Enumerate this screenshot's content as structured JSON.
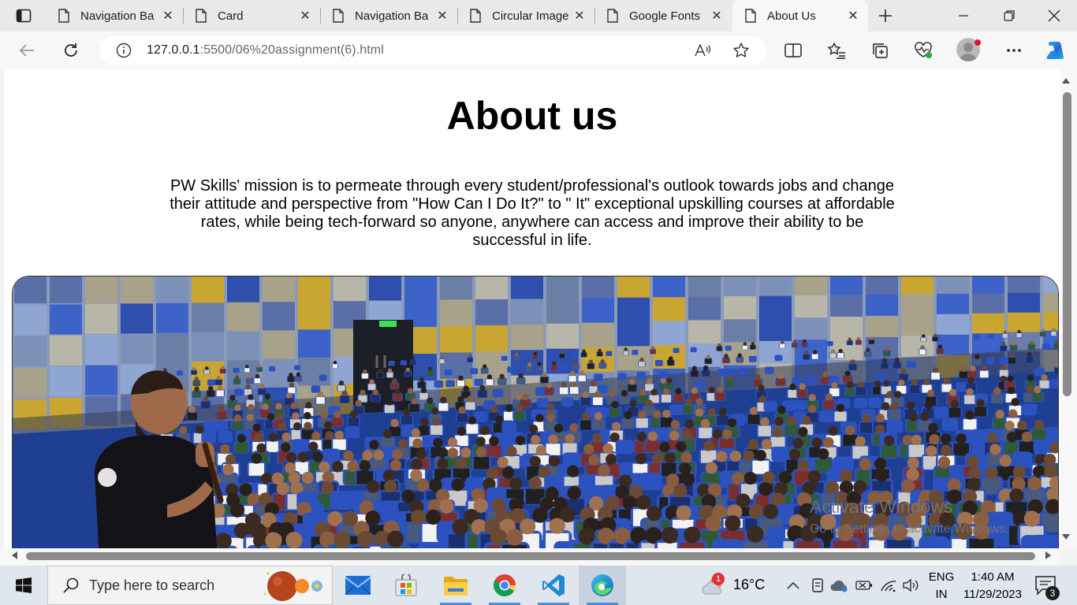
{
  "browser": {
    "tabs": [
      {
        "title": "Navigation Ba",
        "active": false
      },
      {
        "title": "Card",
        "active": false
      },
      {
        "title": "Navigation Ba",
        "active": false
      },
      {
        "title": "Circular Image",
        "active": false
      },
      {
        "title": "Google Fonts",
        "active": false
      },
      {
        "title": "About Us",
        "active": true
      }
    ],
    "close_glyph": "✕",
    "new_tab_glyph": "+",
    "url_host": "127.0.0.1",
    "url_rest": ":5500/06%20assignment(6).html"
  },
  "page": {
    "heading": "About us",
    "paragraph": "PW Skills' mission is to permeate through every student/professional's outlook towards jobs and change their attitude and perspective from \"How Can I Do It?\" to \" It\" exceptional upskilling courses at affordable rates, while being tech-forward so anyone, anywhere can access and improve their ability to be successful in life.",
    "watermark_title": "Activate Windows",
    "watermark_subtitle": "Go to Settings to activate Windows."
  },
  "taskbar": {
    "search_placeholder": "Type here to search",
    "weather_temp": "16°C",
    "weather_badge": "1",
    "lang_line1": "ENG",
    "lang_line2": "IN",
    "time": "1:40 AM",
    "date": "11/29/2023",
    "notification_count": "3"
  },
  "colors": {
    "accent": "#0f6cbd",
    "hall_blue": "#2d57b8",
    "taskbar_bg": "#dfe6ed"
  }
}
